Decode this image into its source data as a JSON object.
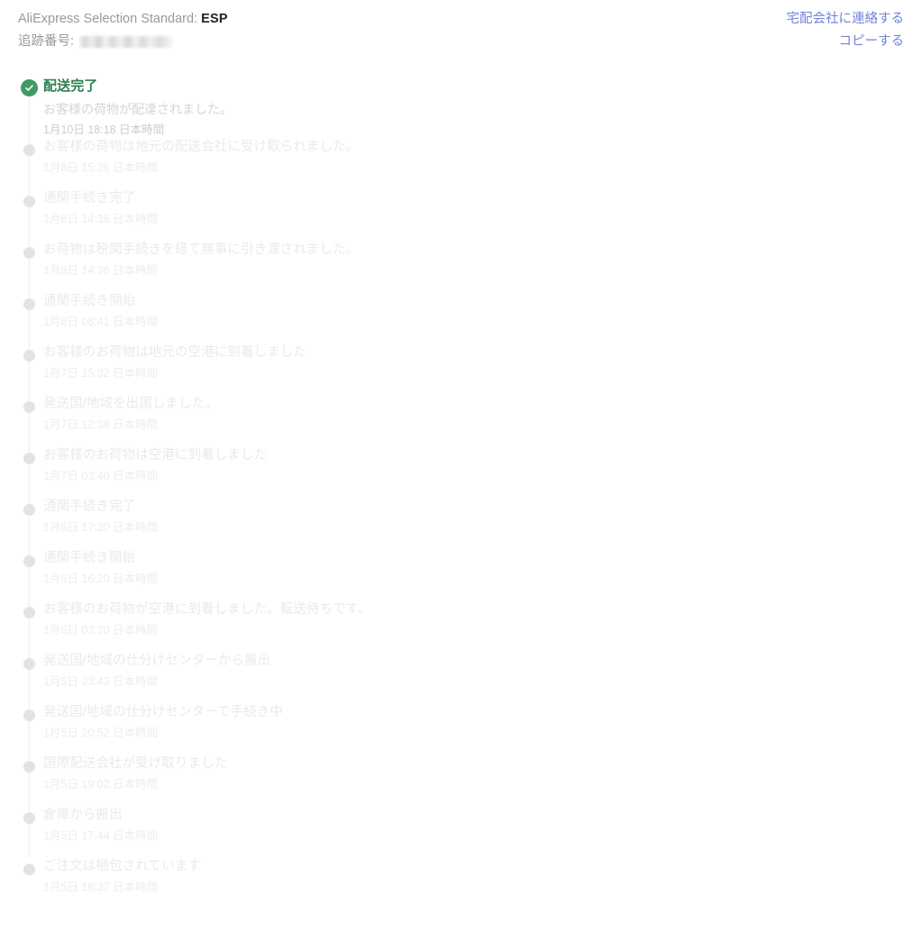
{
  "header": {
    "carrier_label": "AliExpress Selection Standard:",
    "carrier_code": "ESP",
    "tracking_label": "追跡番号:",
    "tracking_number_redacted": "",
    "contact_link": "宅配会社に連絡する",
    "copy_link": "コピーする"
  },
  "colors": {
    "link": "#7183d8",
    "success_green": "#3f9b63",
    "success_text": "#2e7d4f",
    "faded_text": "#eaeaea",
    "rail": "#eeeeee",
    "dot": "#e3e3e3",
    "background": "#ffffff"
  },
  "timeline": {
    "items": [
      {
        "status": "delivered",
        "icon": "check-circle-icon",
        "title": "配送完了",
        "description": "お客様の荷物が配達されました。",
        "time": "1月10日 18:18 日本時間"
      },
      {
        "status": "past",
        "icon": "dot-icon",
        "title": "お客様の荷物は地元の配送会社に受け取られました。",
        "description": "",
        "time": "1月8日 15:36 日本時間"
      },
      {
        "status": "past",
        "icon": "dot-icon",
        "title": "通関手続き完了",
        "description": "",
        "time": "1月8日 14:36 日本時間"
      },
      {
        "status": "past",
        "icon": "dot-icon",
        "title": "お荷物は税関手続きを経て無事に引き渡されました。",
        "description": "",
        "time": "1月8日 14:36 日本時間"
      },
      {
        "status": "past",
        "icon": "dot-icon",
        "title": "通関手続き開始",
        "description": "",
        "time": "1月8日 08:41 日本時間"
      },
      {
        "status": "past",
        "icon": "dot-icon",
        "title": "お客様のお荷物は地元の空港に到着しました",
        "description": "",
        "time": "1月7日 15:32 日本時間"
      },
      {
        "status": "past",
        "icon": "dot-icon",
        "title": "発送国/地域を出国しました。",
        "description": "",
        "time": "1月7日 12:38 日本時間"
      },
      {
        "status": "past",
        "icon": "dot-icon",
        "title": "お客様のお荷物は空港に到着しました",
        "description": "",
        "time": "1月7日 03:40 日本時間"
      },
      {
        "status": "past",
        "icon": "dot-icon",
        "title": "通関手続き完了",
        "description": "",
        "time": "1月6日 17:30 日本時間"
      },
      {
        "status": "past",
        "icon": "dot-icon",
        "title": "通関手続き開始",
        "description": "",
        "time": "1月6日 16:20 日本時間"
      },
      {
        "status": "past",
        "icon": "dot-icon",
        "title": "お客様のお荷物が空港に到着しました。転送待ちです。",
        "description": "",
        "time": "1月6日 03:20 日本時間"
      },
      {
        "status": "past",
        "icon": "dot-icon",
        "title": "発送国/地域の仕分けセンターから搬出",
        "description": "",
        "time": "1月5日 23:43 日本時間"
      },
      {
        "status": "past",
        "icon": "dot-icon",
        "title": "発送国/地域の仕分けセンターで手続き中",
        "description": "",
        "time": "1月5日 20:52 日本時間"
      },
      {
        "status": "past",
        "icon": "dot-icon",
        "title": "国際配送会社が受け取りました",
        "description": "",
        "time": "1月5日 19:02 日本時間"
      },
      {
        "status": "past",
        "icon": "dot-icon",
        "title": "倉庫から搬出",
        "description": "",
        "time": "1月5日 17:44 日本時間"
      },
      {
        "status": "past",
        "icon": "dot-icon",
        "title": "ご注文は梱包されています",
        "description": "",
        "time": "1月5日 16:37 日本時間"
      }
    ]
  }
}
